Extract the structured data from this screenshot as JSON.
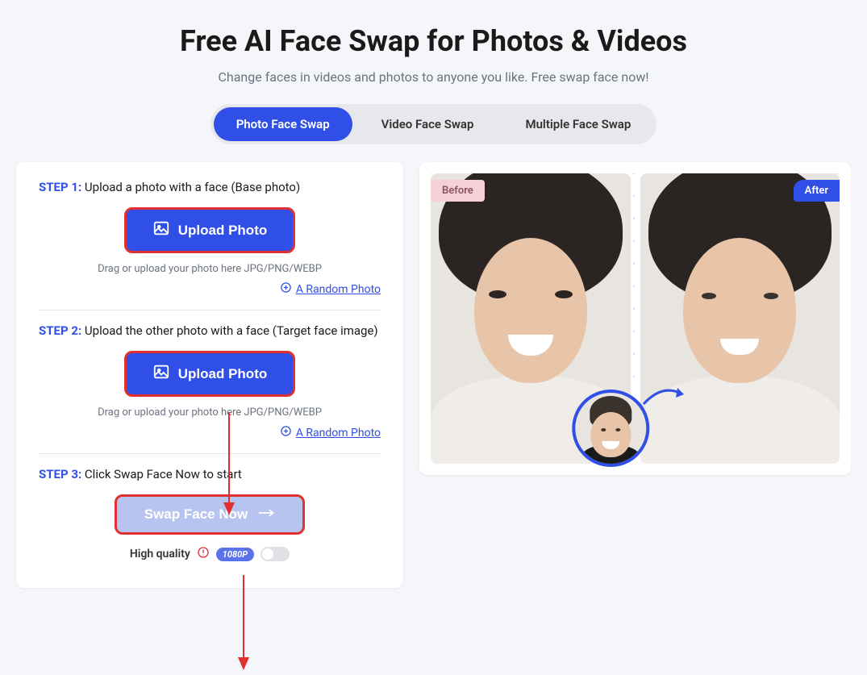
{
  "page": {
    "title": "Free AI Face Swap for Photos & Videos",
    "subtitle": "Change faces in videos and photos to anyone you like. Free swap face now!"
  },
  "tabs": [
    {
      "label": "Photo Face Swap",
      "active": true
    },
    {
      "label": "Video Face Swap",
      "active": false
    },
    {
      "label": "Multiple Face Swap",
      "active": false
    }
  ],
  "steps": {
    "step1": {
      "label": "STEP 1:",
      "text": " Upload a photo with a face (Base photo)",
      "uploadLabel": "Upload Photo",
      "hint": "Drag or upload your photo here JPG/PNG/WEBP",
      "randomLink": "A Random Photo"
    },
    "step2": {
      "label": "STEP 2:",
      "text": " Upload the other photo with a face (Target face image)",
      "uploadLabel": "Upload Photo",
      "hint": "Drag or upload your photo here JPG/PNG/WEBP",
      "randomLink": "A Random Photo"
    },
    "step3": {
      "label": "STEP 3:",
      "text": " Click Swap Face Now to start",
      "swapLabel": "Swap Face Now"
    }
  },
  "quality": {
    "label": "High quality",
    "badge": "1080P"
  },
  "preview": {
    "beforeLabel": "Before",
    "afterLabel": "After"
  }
}
